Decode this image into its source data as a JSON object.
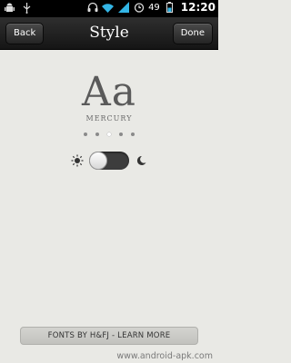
{
  "status_bar": {
    "battery": "49",
    "time": "12:20",
    "left_icons": [
      "android-debug-icon",
      "usb-icon"
    ],
    "right_icons": [
      "headset-icon",
      "wifi-icon",
      "signal-icon",
      "alarm-icon",
      "battery-icon"
    ]
  },
  "header": {
    "back_label": "Back",
    "title": "Style",
    "done_label": "Done"
  },
  "font_preview": {
    "sample": "Aa",
    "font_name": "MERCURY",
    "page_count": 5,
    "active_index": 2
  },
  "theme_toggle": {
    "left_icon": "sun-icon",
    "right_icon": "moon-icon",
    "state": "day"
  },
  "footer": {
    "learn_more_label": "FONTS BY H&FJ - LEARN MORE",
    "watermark": "www.android-apk.com"
  },
  "colors": {
    "background": "#e9e9e5",
    "titlebar": "#1c1c1c",
    "toggle_track": "#3d3d3d"
  }
}
